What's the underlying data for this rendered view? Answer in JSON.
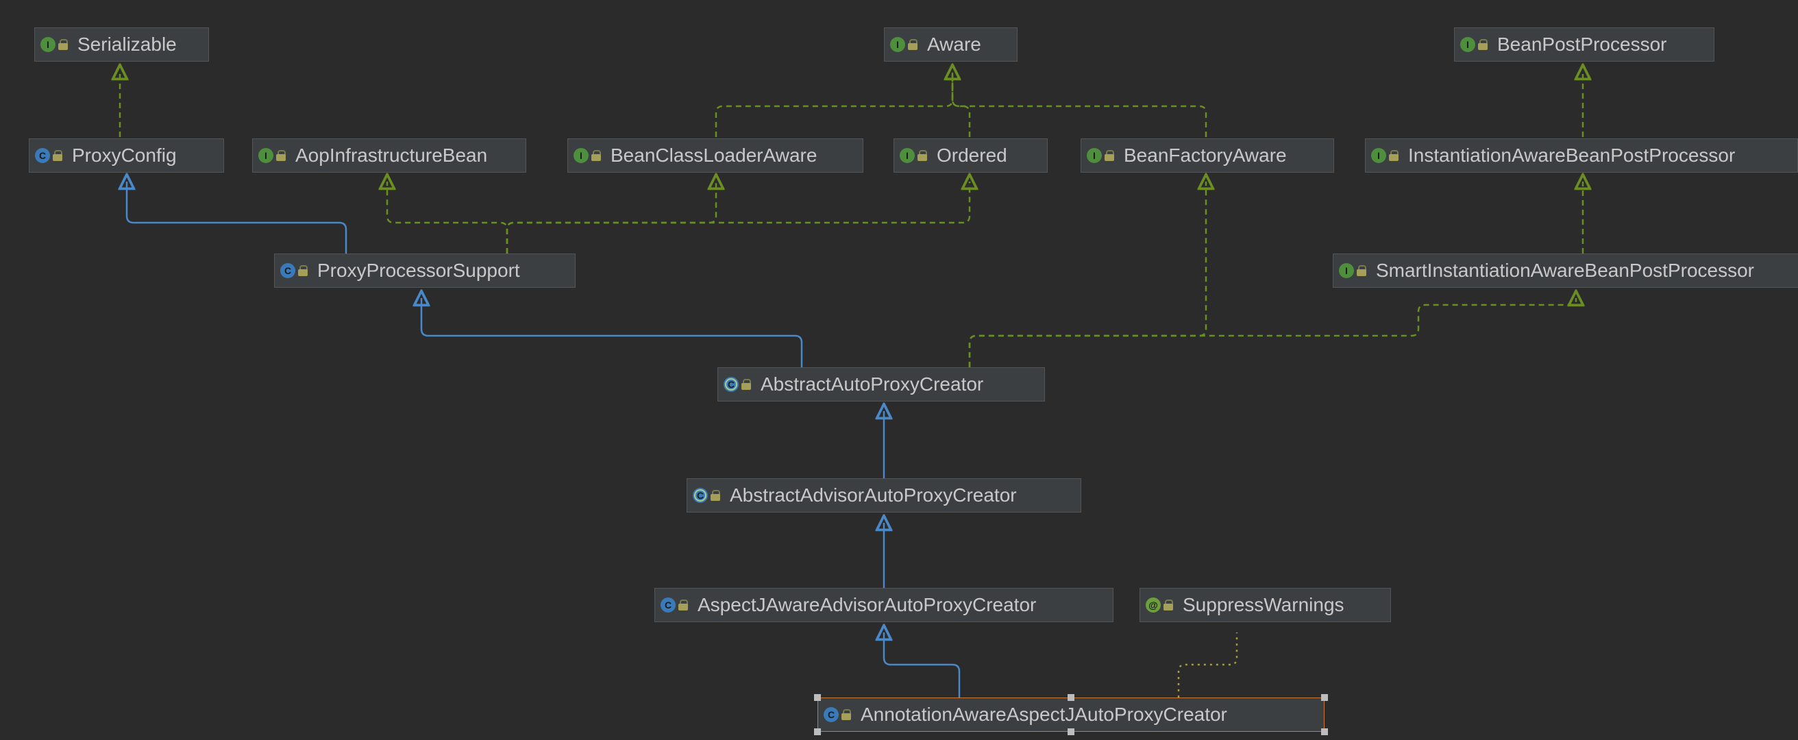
{
  "diagram": {
    "colors": {
      "background": "#2b2b2b",
      "nodeFill": "#3c3f41",
      "interfaceEdge": "#6b8e23",
      "classEdge": "#4a88c7",
      "annotationEdge": "#a59f3e",
      "selection": "#cc7832"
    },
    "nodes": {
      "serializable": {
        "label": "Serializable",
        "kind": "interface"
      },
      "aware": {
        "label": "Aware",
        "kind": "interface"
      },
      "beanPostProcessor": {
        "label": "BeanPostProcessor",
        "kind": "interface"
      },
      "proxyConfig": {
        "label": "ProxyConfig",
        "kind": "class"
      },
      "aopInfraBean": {
        "label": "AopInfrastructureBean",
        "kind": "interface"
      },
      "beanClassLoaderAware": {
        "label": "BeanClassLoaderAware",
        "kind": "interface"
      },
      "ordered": {
        "label": "Ordered",
        "kind": "interface"
      },
      "beanFactoryAware": {
        "label": "BeanFactoryAware",
        "kind": "interface"
      },
      "instAwareBpp": {
        "label": "InstantiationAwareBeanPostProcessor",
        "kind": "interface"
      },
      "proxyProcessorSupport": {
        "label": "ProxyProcessorSupport",
        "kind": "class"
      },
      "smartInstAwareBpp": {
        "label": "SmartInstantiationAwareBeanPostProcessor",
        "kind": "interface"
      },
      "abstractAutoProxyCreator": {
        "label": "AbstractAutoProxyCreator",
        "kind": "abstract"
      },
      "abstractAdvisorAutoProxyCreator": {
        "label": "AbstractAdvisorAutoProxyCreator",
        "kind": "abstract"
      },
      "aspectJAwareAdvisor": {
        "label": "AspectJAwareAdvisorAutoProxyCreator",
        "kind": "class"
      },
      "suppressWarnings": {
        "label": "SuppressWarnings",
        "kind": "annotation"
      },
      "annotationAwareAspectJ": {
        "label": "AnnotationAwareAspectJAutoProxyCreator",
        "kind": "class",
        "selected": true
      }
    },
    "edges": [
      {
        "from": "proxyConfig",
        "to": "serializable",
        "style": "implements"
      },
      {
        "from": "beanClassLoaderAware",
        "to": "aware",
        "style": "implements"
      },
      {
        "from": "ordered",
        "to": "aware",
        "style": "implements"
      },
      {
        "from": "beanFactoryAware",
        "to": "aware",
        "style": "implements"
      },
      {
        "from": "instAwareBpp",
        "to": "beanPostProcessor",
        "style": "implements"
      },
      {
        "from": "proxyProcessorSupport",
        "to": "proxyConfig",
        "style": "extends"
      },
      {
        "from": "proxyProcessorSupport",
        "to": "aopInfraBean",
        "style": "implements"
      },
      {
        "from": "proxyProcessorSupport",
        "to": "beanClassLoaderAware",
        "style": "implements"
      },
      {
        "from": "proxyProcessorSupport",
        "to": "ordered",
        "style": "implements"
      },
      {
        "from": "smartInstAwareBpp",
        "to": "instAwareBpp",
        "style": "implements"
      },
      {
        "from": "abstractAutoProxyCreator",
        "to": "proxyProcessorSupport",
        "style": "extends"
      },
      {
        "from": "abstractAutoProxyCreator",
        "to": "beanFactoryAware",
        "style": "implements"
      },
      {
        "from": "abstractAutoProxyCreator",
        "to": "smartInstAwareBpp",
        "style": "implements"
      },
      {
        "from": "abstractAdvisorAutoProxyCreator",
        "to": "abstractAutoProxyCreator",
        "style": "extends"
      },
      {
        "from": "aspectJAwareAdvisor",
        "to": "abstractAdvisorAutoProxyCreator",
        "style": "extends"
      },
      {
        "from": "annotationAwareAspectJ",
        "to": "aspectJAwareAdvisor",
        "style": "extends"
      },
      {
        "from": "annotationAwareAspectJ",
        "to": "suppressWarnings",
        "style": "annotation"
      }
    ],
    "kindGlyph": {
      "interface": "I",
      "class": "C",
      "abstract": "C",
      "annotation": "@"
    }
  }
}
